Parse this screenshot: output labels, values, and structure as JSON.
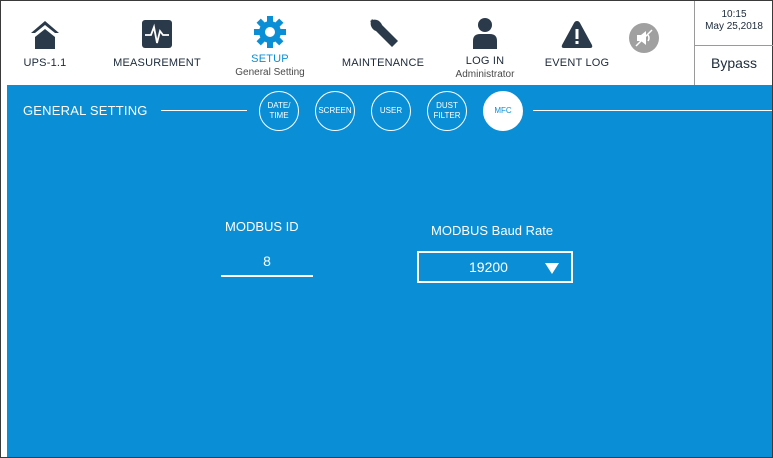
{
  "header": {
    "nav": [
      {
        "id": "ups",
        "label": "UPS-1.1",
        "sub": "",
        "icon": "home-icon"
      },
      {
        "id": "measurement",
        "label": "MEASUREMENT",
        "sub": "",
        "icon": "waveform-icon"
      },
      {
        "id": "setup",
        "label": "SETUP",
        "sub": "General Setting",
        "icon": "gear-icon"
      },
      {
        "id": "maintenance",
        "label": "MAINTENANCE",
        "sub": "",
        "icon": "wrench-icon"
      },
      {
        "id": "login",
        "label": "LOG IN",
        "sub": "Administrator",
        "icon": "user-icon"
      },
      {
        "id": "eventlog",
        "label": "EVENT LOG",
        "sub": "",
        "icon": "warning-icon"
      }
    ],
    "mute_icon": "speaker-muted-icon",
    "time": "10:15",
    "date": "May 25,2018",
    "mode": "Bypass"
  },
  "main": {
    "section_title": "GENERAL SETTING",
    "tabs": [
      {
        "id": "datetime",
        "line1": "DATE/",
        "line2": "TIME"
      },
      {
        "id": "screen",
        "line1": "SCREEN",
        "line2": ""
      },
      {
        "id": "user",
        "line1": "USER",
        "line2": ""
      },
      {
        "id": "dustfilter",
        "line1": "DUST",
        "line2": "FILTER"
      },
      {
        "id": "mfc",
        "line1": "MFC",
        "line2": ""
      }
    ],
    "active_tab": "MFC",
    "modbus_id_label": "MODBUS ID",
    "modbus_id_value": "8",
    "baud_label": "MODBUS Baud Rate",
    "baud_value": "19200"
  },
  "colors": {
    "accent": "#0a8fd6",
    "header_bg": "#ffffff",
    "icon_dark": "#2b3a4a"
  }
}
